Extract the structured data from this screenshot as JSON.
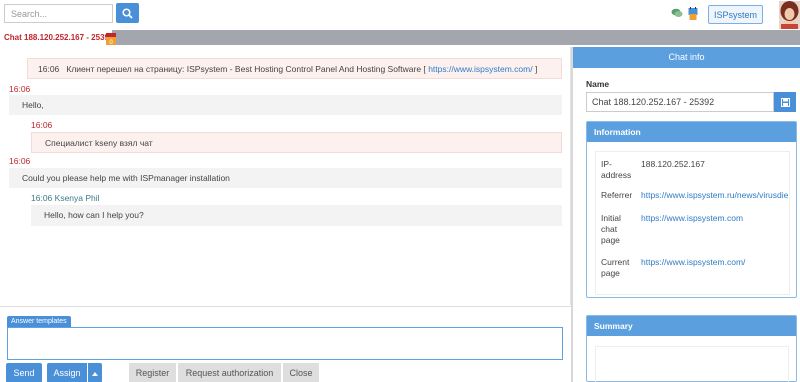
{
  "search": {
    "placeholder": "Search..."
  },
  "header": {
    "brand": "ISPsystem"
  },
  "tab": {
    "label": "Chat 188.120.252.167 - 25392",
    "badge": "0"
  },
  "messages": {
    "m1": {
      "time": "16:06",
      "text": "Клиент перешел на страницу: ISPsystem - Best Hosting Control Panel And Hosting Software [",
      "link": "https://www.ispsystem.com/",
      "tail": "]"
    },
    "m2": {
      "time": "16:06",
      "text": "Hello,"
    },
    "m3": {
      "time": "16:06",
      "text": "Специалист kseny взял чат"
    },
    "m4": {
      "time": "16:06",
      "text": "Could you please help me with ISPmanager installation"
    },
    "m5": {
      "time": "16:06",
      "author": "Ksenya Phil",
      "text": "Hello, how can I help you?"
    }
  },
  "compose": {
    "templates_label": "Answer templates",
    "send": "Send",
    "assign": "Assign",
    "register": "Register",
    "request_auth": "Request authorization",
    "close": "Close"
  },
  "info": {
    "title": "Chat info",
    "name_label": "Name",
    "name_value": "Chat 188.120.252.167 - 25392",
    "information_title": "Information",
    "rows": {
      "ip": {
        "key1": "IP-",
        "key2": "address",
        "value": "188.120.252.167"
      },
      "referrer": {
        "key": "Referrer",
        "value": "https://www.ispsystem.ru/news/virusdie"
      },
      "initial": {
        "key1": "Initial",
        "key2": "chat",
        "key3": "page",
        "value": "https://www.ispsystem.com"
      },
      "current": {
        "key1": "Current",
        "key2": "page",
        "value": "https://www.ispsystem.com/"
      }
    },
    "summary_title": "Summary"
  },
  "colors": {
    "accent": "#4a90d9",
    "panel_header": "#5c9fdf",
    "alert_red": "#c0262b"
  }
}
